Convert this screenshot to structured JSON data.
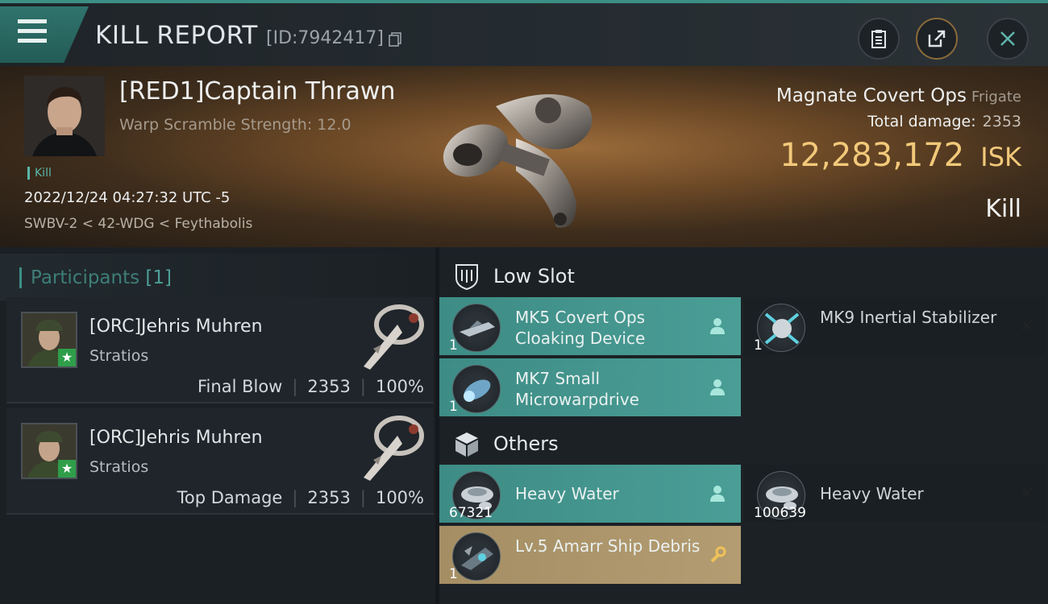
{
  "header": {
    "title": "KILL REPORT",
    "id_text": "[ID:7942417]"
  },
  "victim": {
    "name": "[RED1]Captain Thrawn",
    "warp_scramble": "Warp Scramble Strength: 12.0",
    "kill_tag": "Kill",
    "timestamp": "2022/12/24 04:27:32 UTC -5",
    "location": "SWBV-2 < 42-WDG < Feythabolis"
  },
  "ship": {
    "name": "Magnate Covert Ops",
    "class": "Frigate",
    "total_damage_label": "Total damage:",
    "total_damage": "2353",
    "isk_value": "12,283,172",
    "isk_unit": "ISK",
    "result": "Kill"
  },
  "participants": {
    "label": "Participants",
    "count": "[1]",
    "items": [
      {
        "name": "[ORC]Jehris Muhren",
        "ship": "Stratios",
        "role": "Final Blow",
        "damage": "2353",
        "percent": "100%"
      },
      {
        "name": "[ORC]Jehris Muhren",
        "ship": "Stratios",
        "role": "Top Damage",
        "damage": "2353",
        "percent": "100%"
      }
    ]
  },
  "sections": {
    "low_slot": "Low Slot",
    "others": "Others"
  },
  "modules": [
    {
      "name": "MK5 Covert Ops Cloaking Device",
      "qty": "1",
      "status": "dropped"
    },
    {
      "name": "MK9 Inertial Stabilizer",
      "qty": "1",
      "status": "destroyed"
    },
    {
      "name": "MK7 Small Microwarpdrive",
      "qty": "1",
      "status": "dropped"
    },
    {
      "name": "Heavy Water",
      "qty": "67321",
      "status": "dropped"
    },
    {
      "name": "Heavy Water",
      "qty": "100639",
      "status": "destroyed"
    },
    {
      "name": "Lv.5 Amarr Ship Debris",
      "qty": "1",
      "status": "salvage"
    }
  ],
  "colors": {
    "accent_teal": "#3d8c85",
    "isk_gold": "#f2c97a",
    "salvage_gold": "#a58e64"
  }
}
